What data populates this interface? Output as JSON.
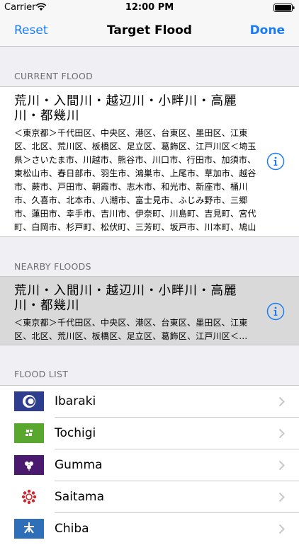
{
  "status": {
    "carrier": "Carrier",
    "time": "12:00 PM"
  },
  "nav": {
    "left": "Reset",
    "title": "Target Flood",
    "right": "Done"
  },
  "current": {
    "header": "CURRENT FLOOD",
    "name": "荒川・入間川・越辺川・小畔川・高麗川・都幾川",
    "description": "＜東京都＞千代田区、中央区、港区、台東区、墨田区、江東区、北区、荒川区、板橋区、足立区、葛飾区、江戸川区＜埼玉県＞さいたま市、川越市、熊谷市、川口市、行田市、加須市、東松山市、春日部市、羽生市、鴻巣市、上尾市、草加市、越谷市、蕨市、戸田市、朝霞市、志木市、和光市、新座市、桶川市、久喜市、北本市、八潮市、富士見市、ふじみ野市、三郷市、蓮田市、幸手市、吉川市、伊奈町、川島町、吉見町、宮代町、白岡市、杉戸町、松伏町、三芳町、坂戸市、川本町、鳩山町、毛呂山町"
  },
  "nearby": {
    "header": "NEARBY FLOODS",
    "name": "荒川・入間川・越辺川・小畔川・高麗川・都幾川",
    "description": "＜東京都＞千代田区、中央区、港区、台東区、墨田区、江東区、北区、荒川区、板橋区、足立区、葛飾区、江戸川区＜…"
  },
  "list": {
    "header": "FLOOD LIST",
    "items": [
      {
        "label": "Ibaraki",
        "icon": "ibaraki-flag-icon",
        "color": "#2f3d8f"
      },
      {
        "label": "Tochigi",
        "icon": "tochigi-flag-icon",
        "color": "#5aa72f"
      },
      {
        "label": "Gumma",
        "icon": "gumma-flag-icon",
        "color": "#4a1a6f"
      },
      {
        "label": "Saitama",
        "icon": "saitama-flag-icon",
        "color": "#d4232b"
      },
      {
        "label": "Chiba",
        "icon": "chiba-flag-icon",
        "color": "#2f6fb7"
      }
    ]
  },
  "colors": {
    "accent": "#1a7cf5",
    "background": "#efeff4",
    "selected": "#d9d9d9"
  }
}
